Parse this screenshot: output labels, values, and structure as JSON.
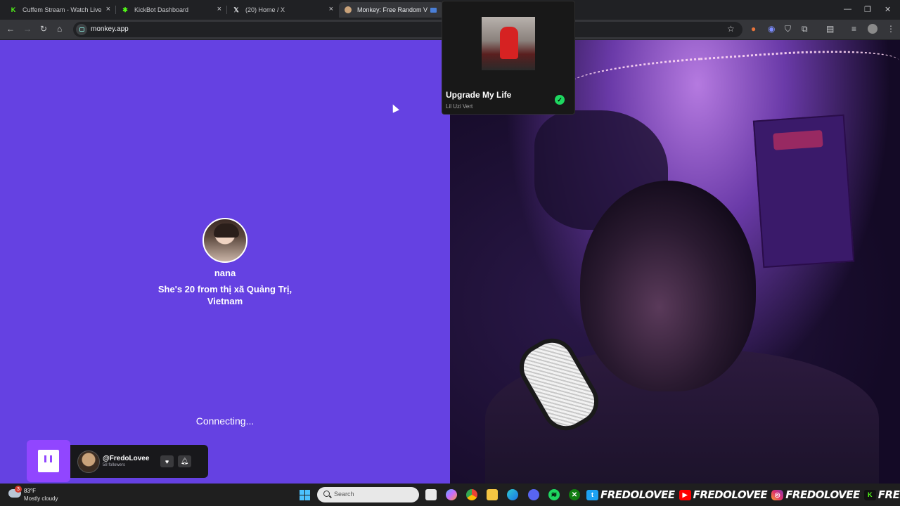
{
  "browser": {
    "tabs": [
      {
        "title": "Cuffem Stream - Watch Live on",
        "favicon": "kick-icon",
        "active": false
      },
      {
        "title": "KickBot Dashboard",
        "favicon": "kickbot-icon",
        "active": false
      },
      {
        "title": "(20) Home / X",
        "favicon": "x-icon",
        "active": false
      },
      {
        "title": "Monkey: Free Random Vide",
        "favicon": "monkey-icon",
        "active": true
      }
    ],
    "url": "monkey.app"
  },
  "monkey": {
    "username": "nana",
    "bio_line1": "She's 20 from thị xã Quảng Trị,",
    "bio_line2": "Vietnam",
    "status": "Connecting..."
  },
  "spotify": {
    "song": "Upgrade My Life",
    "artist": "Lil Uzi Vert"
  },
  "twitch": {
    "handle": "@FredoLovee",
    "followers": "58 followers"
  },
  "taskbar": {
    "weather_temp": "83°F",
    "weather_desc": "Mostly cloudy",
    "weather_badge": "3",
    "search_placeholder": "Search",
    "socials": [
      {
        "platform": "twitter",
        "handle": "FREDOLOVEE"
      },
      {
        "platform": "youtube",
        "handle": "FREDOLOVEE"
      },
      {
        "platform": "instagram",
        "handle": "FREDOLOVEE"
      },
      {
        "platform": "kick",
        "handle": "FREDOLOVEE"
      }
    ]
  },
  "colors": {
    "monkey_purple": "#6541e2",
    "twitch_purple": "#9146ff",
    "spotify_green": "#1ed760",
    "kick_green": "#53fc18"
  }
}
